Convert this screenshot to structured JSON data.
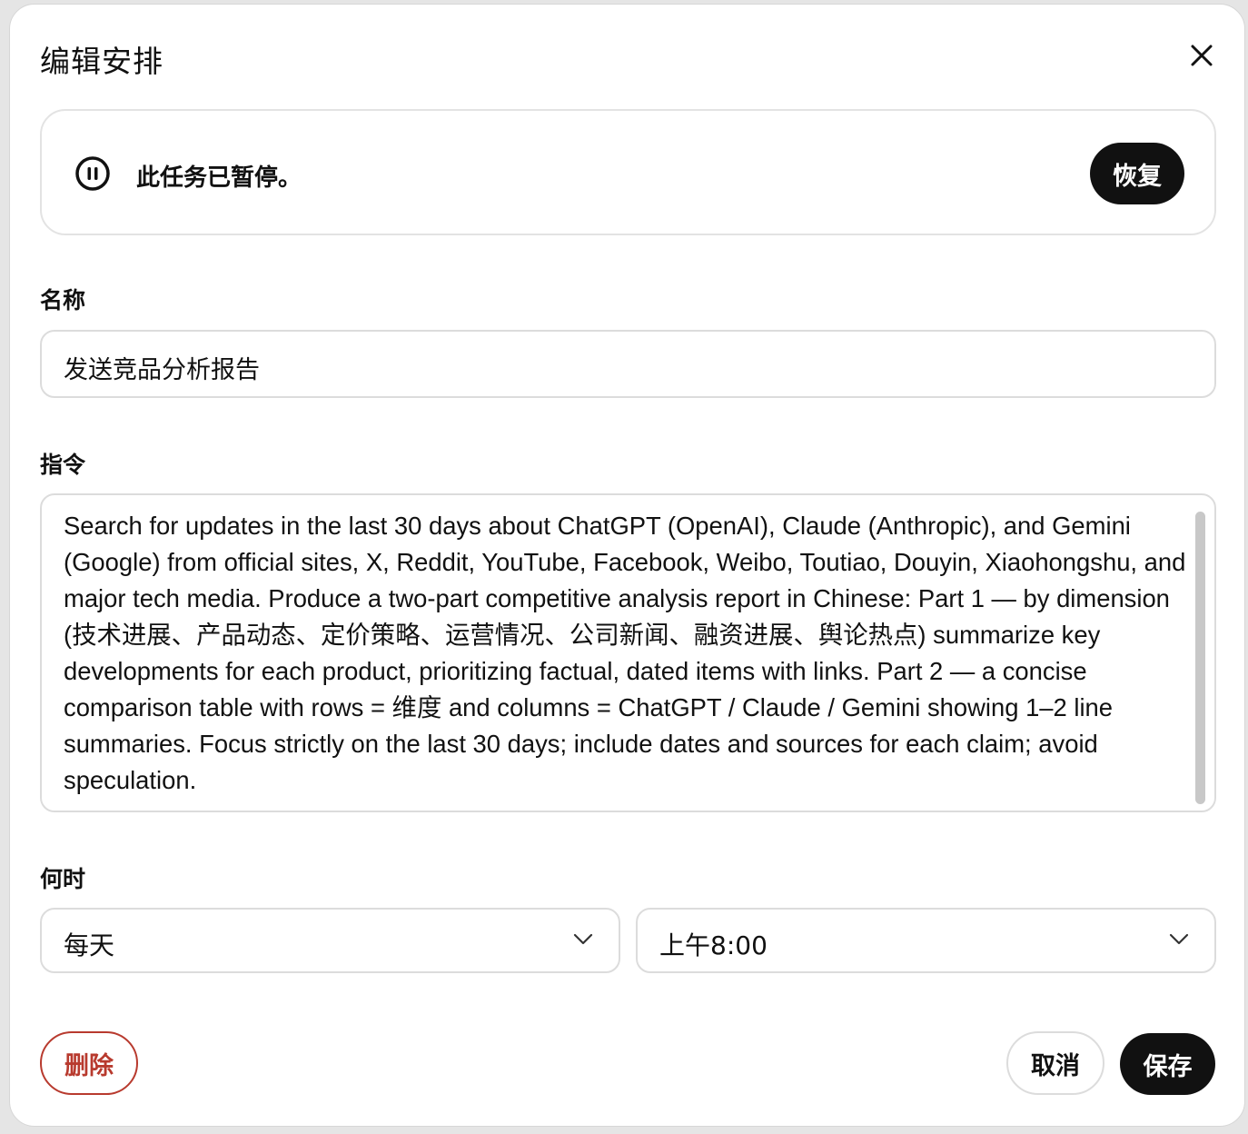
{
  "dialog": {
    "title": "编辑安排"
  },
  "status": {
    "message": "此任务已暂停。",
    "resume_label": "恢复",
    "icon": "pause-circle-icon"
  },
  "name": {
    "label": "名称",
    "value": "发送竞品分析报告"
  },
  "instructions": {
    "label": "指令",
    "value": "Search for updates in the last 30 days about ChatGPT (OpenAI), Claude (Anthropic), and Gemini (Google) from official sites, X, Reddit, YouTube, Facebook, Weibo, Toutiao, Douyin, Xiaohongshu, and major tech media. Produce a two-part competitive analysis report in Chinese: Part 1 — by dimension (技术进展、产品动态、定价策略、运营情况、公司新闻、融资进展、舆论热点) summarize key developments for each product, prioritizing factual, dated items with links. Part 2 — a concise comparison table with rows = 维度 and columns = ChatGPT / Claude / Gemini showing 1–2 line summaries. Focus strictly on the last 30 days; include dates and sources for each claim; avoid speculation."
  },
  "schedule": {
    "label": "何时",
    "frequency": "每天",
    "time": "上午8:00"
  },
  "actions": {
    "delete_label": "删除",
    "cancel_label": "取消",
    "save_label": "保存"
  },
  "colors": {
    "primary_button": "#111111",
    "danger": "#b83a2e",
    "border": "#dcdcdc"
  }
}
